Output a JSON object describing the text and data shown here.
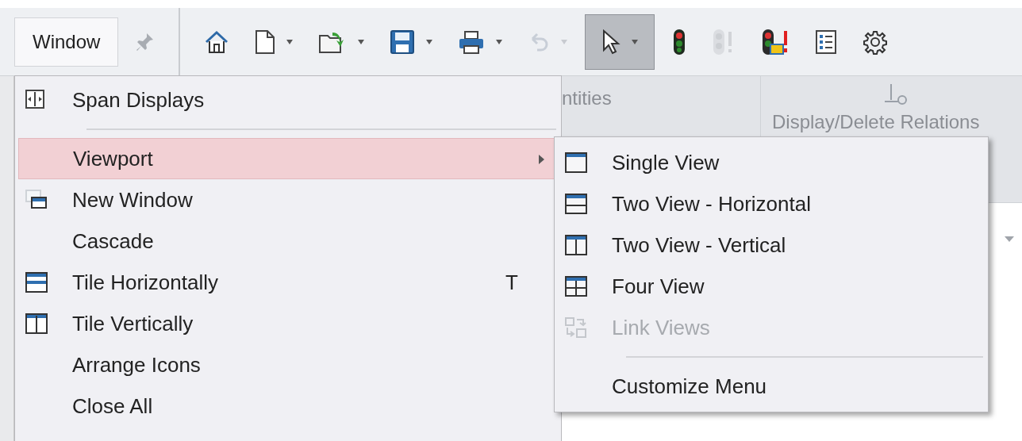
{
  "toolbar": {
    "window_button": "Window",
    "tools": [
      {
        "kind": "home",
        "dropdown": false,
        "disabled": false,
        "selected": false
      },
      {
        "kind": "new",
        "dropdown": true,
        "disabled": false,
        "selected": false
      },
      {
        "kind": "open",
        "dropdown": true,
        "disabled": false,
        "selected": false
      },
      {
        "kind": "save",
        "dropdown": true,
        "disabled": false,
        "selected": false
      },
      {
        "kind": "print",
        "dropdown": true,
        "disabled": false,
        "selected": false
      },
      {
        "kind": "undo",
        "dropdown": true,
        "disabled": true,
        "selected": false
      },
      {
        "kind": "select",
        "dropdown": true,
        "disabled": false,
        "selected": true
      },
      {
        "kind": "traffic",
        "dropdown": false,
        "disabled": false,
        "selected": false
      },
      {
        "kind": "rebuild",
        "dropdown": false,
        "disabled": true,
        "selected": false
      },
      {
        "kind": "warn",
        "dropdown": false,
        "disabled": false,
        "selected": false
      },
      {
        "kind": "list",
        "dropdown": false,
        "disabled": false,
        "selected": false
      },
      {
        "kind": "gear",
        "dropdown": false,
        "disabled": false,
        "selected": false
      }
    ]
  },
  "ribbon": {
    "group_1": "ntities",
    "group_2": "Display/Delete Relations"
  },
  "window_menu": {
    "items": [
      {
        "kind": "span",
        "label": "Span Displays",
        "selected": false,
        "submenu": false
      },
      {
        "kind": "separator"
      },
      {
        "kind": "none",
        "label": "Viewport",
        "selected": true,
        "submenu": true
      },
      {
        "kind": "new-window",
        "label": "New Window",
        "selected": false,
        "submenu": false
      },
      {
        "kind": "none",
        "label": "Cascade",
        "selected": false,
        "submenu": false
      },
      {
        "kind": "tile-h",
        "label": "Tile Horizontally",
        "shortcut": "T",
        "selected": false,
        "submenu": false
      },
      {
        "kind": "tile-v",
        "label": "Tile Vertically",
        "selected": false,
        "submenu": false
      },
      {
        "kind": "none",
        "label": "Arrange Icons",
        "selected": false,
        "submenu": false
      },
      {
        "kind": "none",
        "label": "Close All",
        "selected": false,
        "submenu": false
      }
    ]
  },
  "viewport_menu": {
    "items": [
      {
        "kind": "single",
        "label": "Single View",
        "disabled": false
      },
      {
        "kind": "two-h",
        "label": "Two View - Horizontal",
        "disabled": false
      },
      {
        "kind": "two-v",
        "label": "Two View - Vertical",
        "disabled": false
      },
      {
        "kind": "four",
        "label": "Four View",
        "disabled": false
      },
      {
        "kind": "link",
        "label": "Link Views",
        "disabled": true
      },
      {
        "kind": "separator"
      },
      {
        "kind": "none",
        "label": "Customize Menu",
        "disabled": false
      }
    ]
  }
}
